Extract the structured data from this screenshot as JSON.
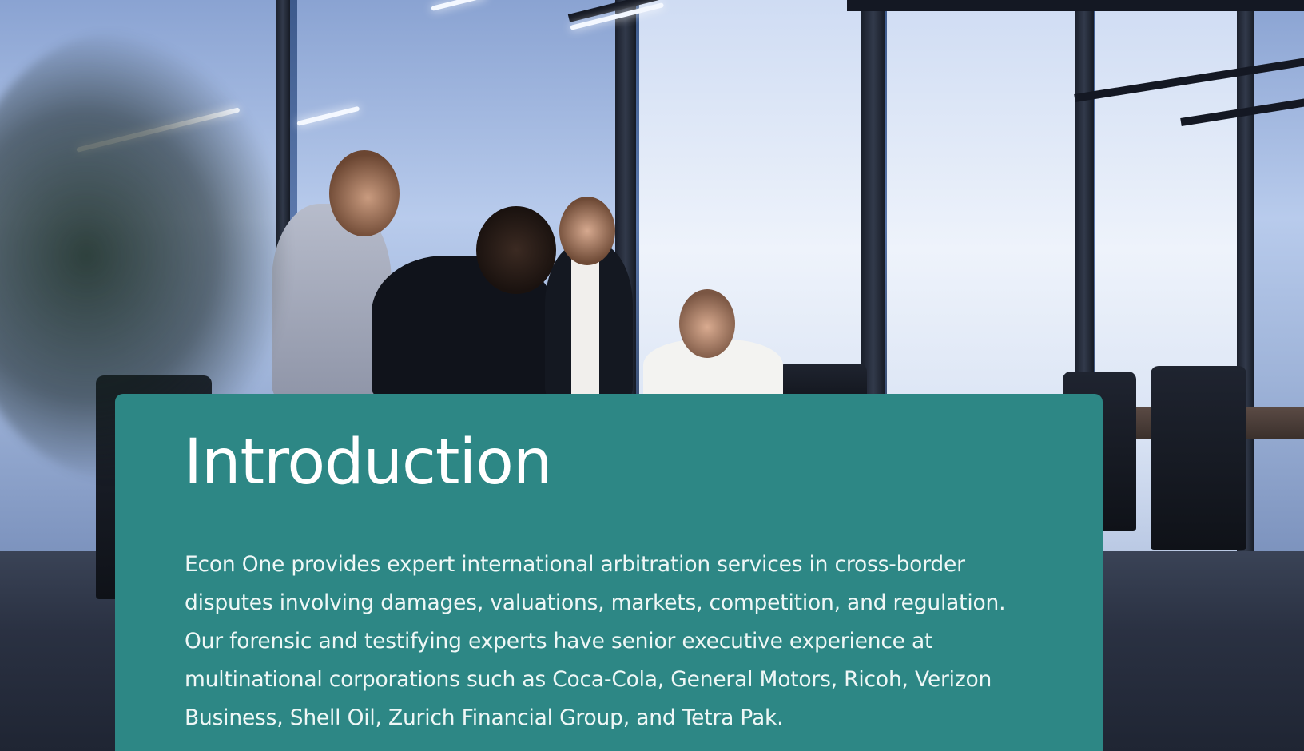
{
  "hero": {
    "image": "office-meeting-photo",
    "card_color": "#2d8785"
  },
  "intro": {
    "title": "Introduction",
    "body": "Econ One provides expert international arbitration services in cross-border disputes involving damages, valuations, markets, competition, and regulation. Our forensic and testifying experts have senior executive experience at multinational corporations such as Coca-Cola, General Motors, Ricoh, Verizon Business, Shell Oil, Zurich Financial Group, and Tetra Pak."
  }
}
